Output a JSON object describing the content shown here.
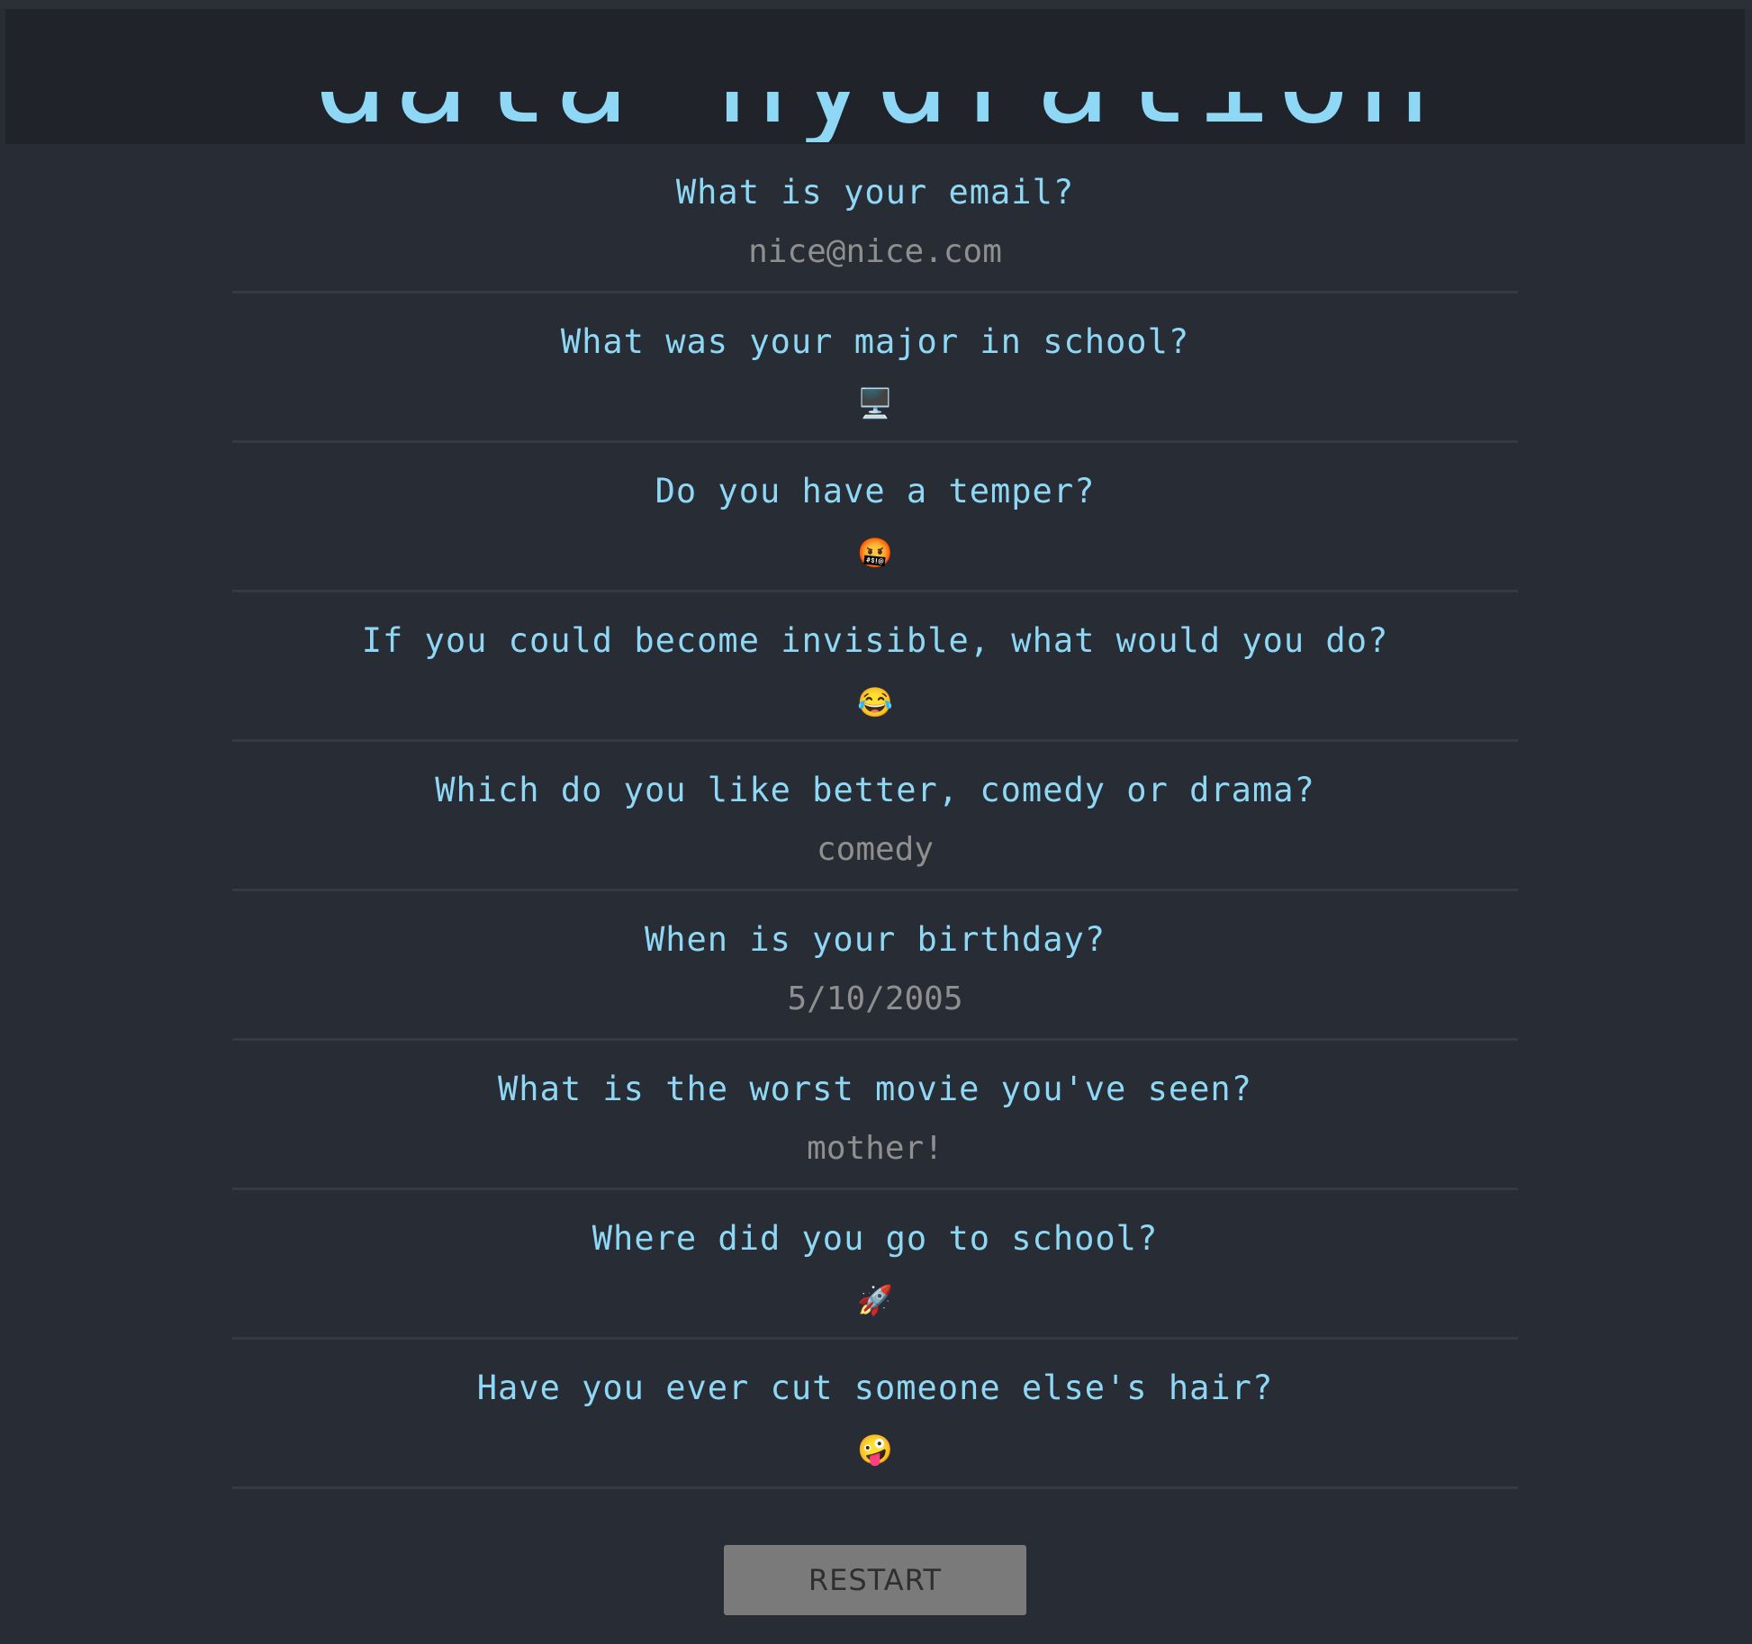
{
  "header": {
    "title": "data hydration"
  },
  "questions": [
    {
      "question": "What is your email?",
      "answer": "nice@nice.com"
    },
    {
      "question": "What was your major in school?",
      "answer": "🖥️"
    },
    {
      "question": "Do you have a temper?",
      "answer": "🤬"
    },
    {
      "question": "If you could become invisible, what would you do?",
      "answer": "😂"
    },
    {
      "question": "Which do you like better, comedy or drama?",
      "answer": "comedy"
    },
    {
      "question": "When is your birthday?",
      "answer": "5/10/2005"
    },
    {
      "question": "What is the worst movie you've seen?",
      "answer": "mother!"
    },
    {
      "question": "Where did you go to school?",
      "answer": "🚀"
    },
    {
      "question": "Have you ever cut someone else's hair?",
      "answer": "🤪"
    }
  ],
  "restart_button": {
    "label": "RESTART"
  },
  "colors": {
    "background": "#282c34",
    "header_background": "#20232a",
    "question": "#8ed8f5",
    "answer": "#8f8f8f",
    "button": "#7a7a7a"
  }
}
